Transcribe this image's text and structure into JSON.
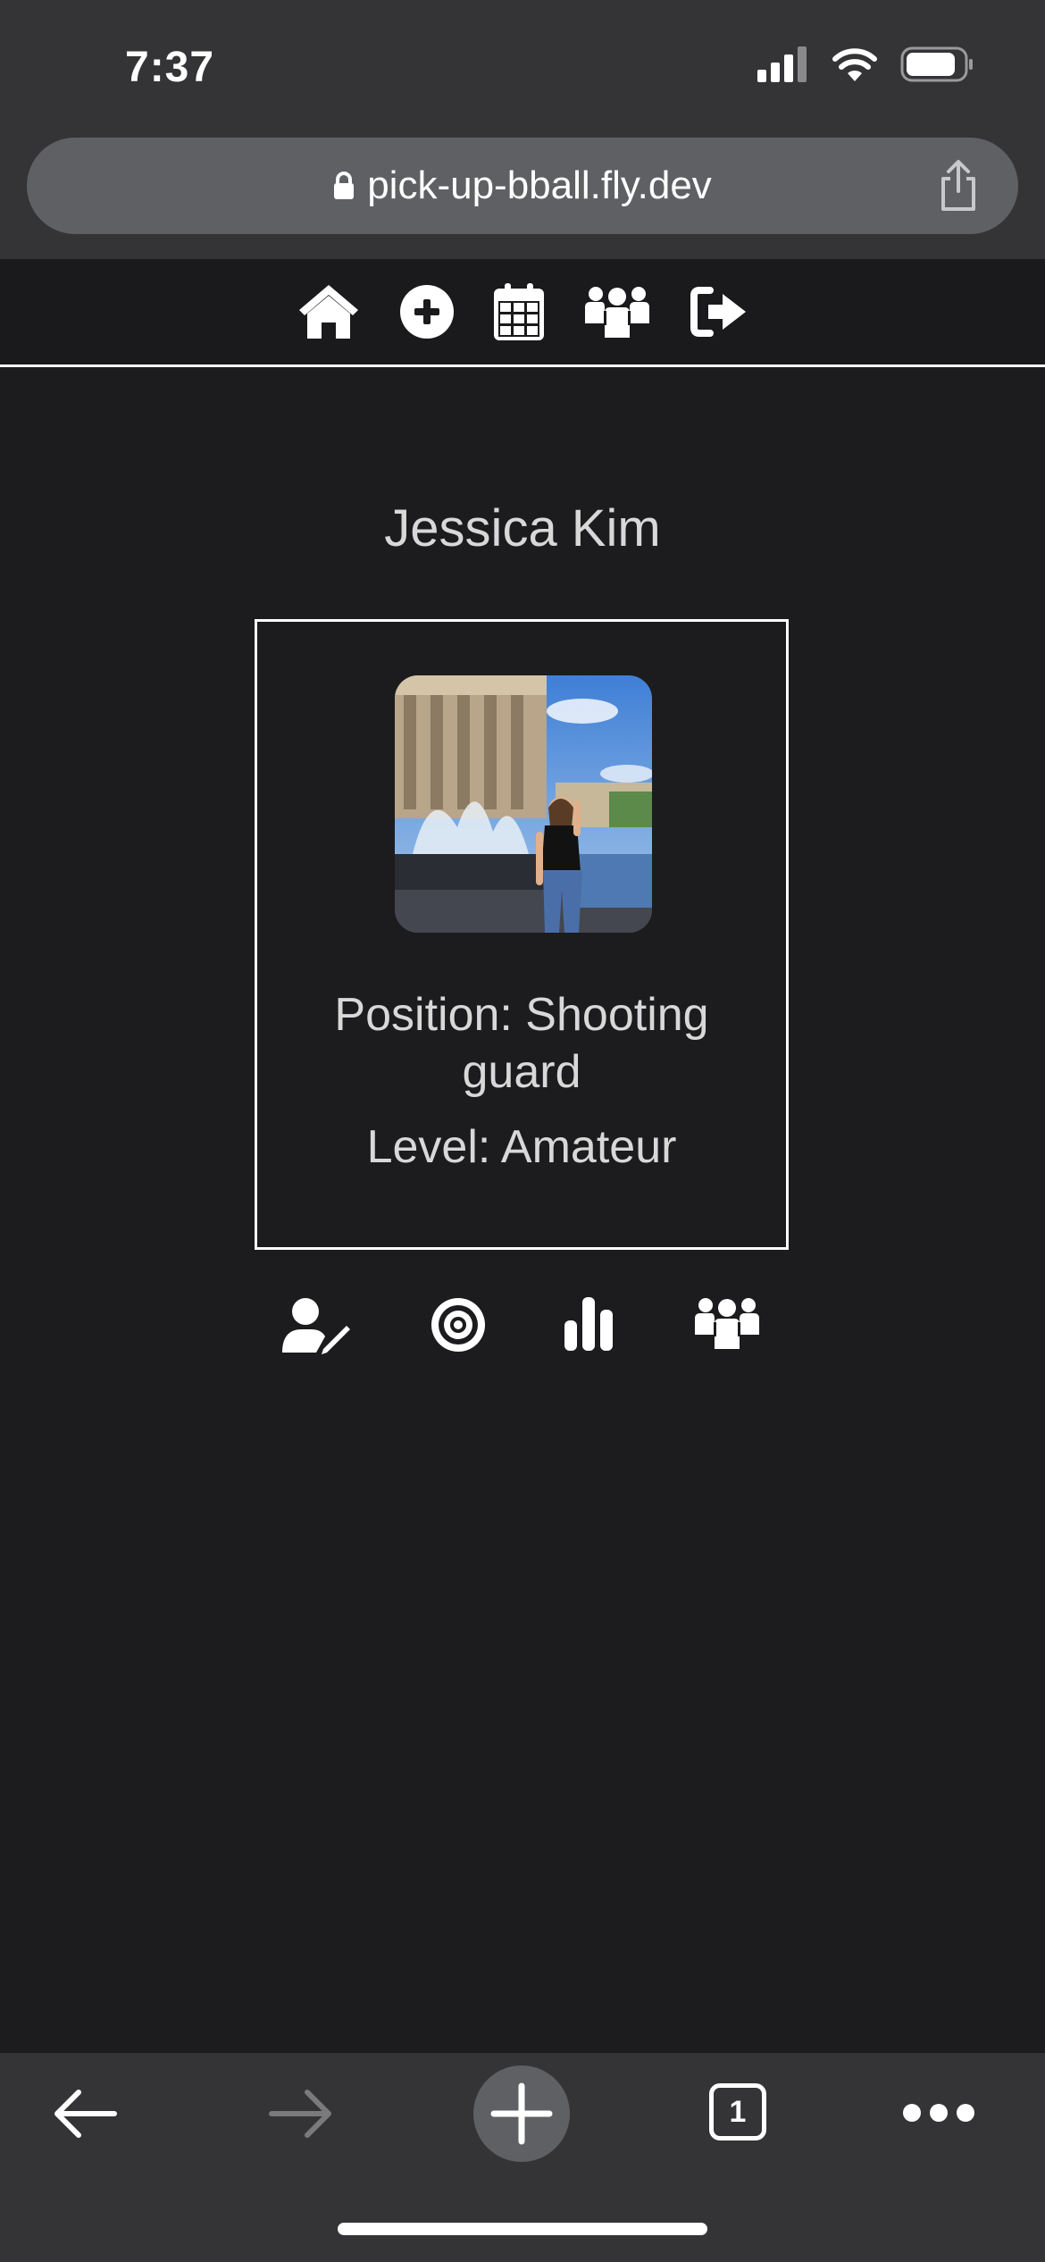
{
  "status_bar": {
    "time": "7:37",
    "icons": [
      "cellular-signal-icon",
      "wifi-icon",
      "battery-icon"
    ]
  },
  "browser": {
    "url": "pick-up-bball.fly.dev",
    "icons": [
      "lock-icon",
      "share-icon"
    ]
  },
  "app_nav": {
    "items": [
      "home-icon",
      "add-game-icon",
      "calendar-icon",
      "players-icon",
      "logout-icon"
    ]
  },
  "profile": {
    "name": "Jessica Kim",
    "position_line1": "Position: Shooting",
    "position_line2": "guard",
    "level": "Level: Amateur",
    "photo": "profile-photo"
  },
  "profile_actions": [
    "edit-profile-icon",
    "target-icon",
    "stats-icon",
    "team-icon"
  ],
  "browser_toolbar": {
    "back": "back-arrow-icon",
    "forward": "forward-arrow-icon",
    "new_tab": "plus-icon",
    "tab_count": "1",
    "menu": "more-icon"
  },
  "colors": {
    "background": "#1c1c1e",
    "chrome": "#343436",
    "url_field": "#5e6064",
    "text": "#d8d8d8",
    "border": "#ffffff"
  }
}
